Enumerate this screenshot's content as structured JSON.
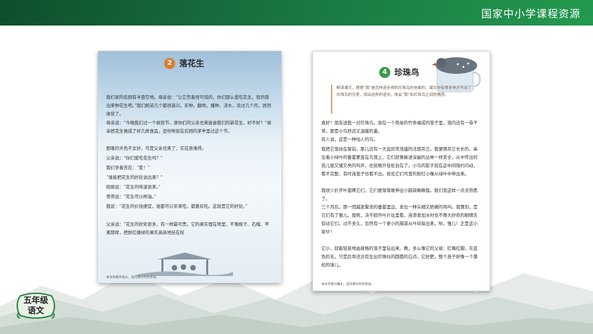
{
  "header": {
    "title": "国家中小学课程资源"
  },
  "grade_badge": {
    "line1": "五年级",
    "line2": "语文"
  },
  "left_page": {
    "lesson_number": "2",
    "lesson_title": "落花生",
    "paragraphs": [
      "我们家的后园有半亩空地。母亲说：“让它荒着怪可惜的，你们那么爱吃花生，就开辟出来种花生吧。”我们姐弟几个都很高兴，买种，翻地，播种，浇水，没过几个月，居然收获了。",
      "母亲说：“今晚我们过一个收获节，请你们的父亲也来尝尝我们的新花生，好不好？”母亲把花生做成了好几样食品，还吩咐就在后园的茅亭里过这个节。",
      "那晚的天色不太好，可是父亲也来了，实在很难得。",
      "父亲说：“你们爱吃花生吗？”",
      "我们争着答应：“爱！”",
      "“谁能把花生的好处说出来？”",
      "姐姐说：“花生的味道很美。”",
      "哥哥说：“花生可以榨油。”",
      "我说：“花生的价钱便宜，谁都可以买来吃，都喜欢吃。这就是它的好处。”",
      "父亲说：“花生的好处很多，有一样最可贵。它的果实埋在地里，不像桃子、石榴、苹果那样，把鲜红嫩绿的果实高高地挂在枝"
    ],
    "footnote": "本文作者许地山，选作课文时有改动。"
  },
  "right_page": {
    "lesson_number": "4",
    "lesson_title": "珍珠鸟",
    "intro": "默读课文，想想“我”是怎样逐步得到珍珠鸟的信赖的，课文中有很多地方写出了珍珠鸟的可爱，找出这样的语句，体会“我”和珍珠鸟之间的情感。",
    "paragraphs": [
      "真好！朋友送我一对珍珠鸟。放在一个简易的竹条编成的笼子里，笼内还有一卷干草，那是小鸟舒适又温暖的巢。",
      "有人说，这是一种怕人的鸟。",
      "我把它笼挂在窗前。那儿还有一大盆异常茂盛的法国吊兰。我便用吊兰长长的、串生着小绿叶的垂蔓蒙盖在鸟笼上，它们就像躲进深幽的丛林一样安全，从中传出的笛儿般又细又亮的叫声，也就格外轻松自在了。小鸟的影子就在这中间隐约闪动，看不完整，有时连笼子也看不出，却见它们可爱的鲜红小嘴从绿叶中伸出来。",
      "我很少扒开叶蔓瞧它们，它们便渐渐敢伸出小脑袋瞅瞅我。我们就这样一点点熟悉了。",
      "三个月后，那一团越发繁茂的垂蔓里边，发出一种尖细又娇嫩的鸣叫。我猜到，是它们有了雏儿。我呢，决不掀开叶片往里看，连添食加水时也不睁大好奇的眼睛去惊动它们。过不多久，忽然有一个更小的脑袋从叶间探出来。哟，雏儿！正是这小家伙！",
      "它小，就能轻易地由疏格的笼子里钻出来。瞧，多么像它的父母：红嘴红脚，灰蓝色的毛，只是后背还没有生出珍珠似的圆圆的白点。它好肥，整个身子好像一个蓬松的球儿。"
    ],
    "footnote": "本文作者冯骥才，选作课文时有改动。"
  },
  "colors": {
    "header_dark": "#0f4f2c",
    "header_light": "#23994f",
    "orange_badge": "#e07b2c",
    "green_badge": "#3a9a4a"
  }
}
